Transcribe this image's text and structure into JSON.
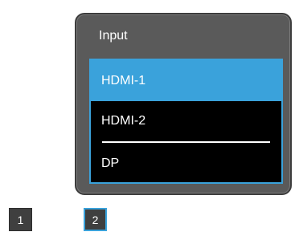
{
  "osd": {
    "title": "Input",
    "items": [
      {
        "label": "HDMI-1",
        "selected": true
      },
      {
        "label": "HDMI-2",
        "selected": false
      },
      {
        "label": "DP",
        "selected": false
      }
    ]
  },
  "keys": [
    {
      "label": "1",
      "active": false
    },
    {
      "label": "2",
      "active": true
    }
  ],
  "colors": {
    "accent": "#3aa2db",
    "panel": "#5a5a5a",
    "menu_bg": "#000000",
    "key_bg": "#3f3f3f"
  }
}
